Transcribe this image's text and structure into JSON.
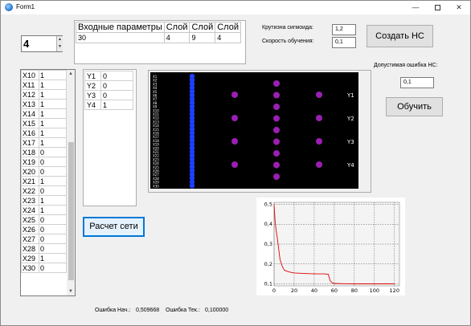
{
  "window": {
    "title": "Form1",
    "minimize": "—",
    "close": "✕"
  },
  "layers_count": "4",
  "input_params": {
    "header": [
      "Входные параметры",
      "Слой",
      "Слой",
      "Слой"
    ],
    "row": [
      "30",
      "4",
      "9",
      "4"
    ]
  },
  "sigmoid": {
    "label": "Крутизна сигмоида:",
    "value": "1,2"
  },
  "learning_rate": {
    "label": "Скорость обучения:",
    "value": "0,1"
  },
  "create_button": "Создать НС",
  "tolerance": {
    "label": "Допустимая ошибка НС:",
    "value": "0,1"
  },
  "train_button": "Обучить",
  "calc_button": "Расчет сети",
  "x_inputs": [
    {
      "k": "X10",
      "v": "1"
    },
    {
      "k": "X11",
      "v": "1"
    },
    {
      "k": "X12",
      "v": "1"
    },
    {
      "k": "X13",
      "v": "1"
    },
    {
      "k": "X14",
      "v": "1"
    },
    {
      "k": "X15",
      "v": "1"
    },
    {
      "k": "X16",
      "v": "1"
    },
    {
      "k": "X17",
      "v": "1"
    },
    {
      "k": "X18",
      "v": "0"
    },
    {
      "k": "X19",
      "v": "0"
    },
    {
      "k": "X20",
      "v": "0"
    },
    {
      "k": "X21",
      "v": "1"
    },
    {
      "k": "X22",
      "v": "0"
    },
    {
      "k": "X23",
      "v": "1"
    },
    {
      "k": "X24",
      "v": "1"
    },
    {
      "k": "X25",
      "v": "0"
    },
    {
      "k": "X26",
      "v": "0"
    },
    {
      "k": "X27",
      "v": "0"
    },
    {
      "k": "X28",
      "v": "0"
    },
    {
      "k": "X29",
      "v": "1"
    },
    {
      "k": "X30",
      "v": "0"
    }
  ],
  "y_outputs": [
    {
      "k": "Y1",
      "v": "0"
    },
    {
      "k": "Y2",
      "v": "0"
    },
    {
      "k": "Y3",
      "v": "0"
    },
    {
      "k": "Y4",
      "v": "1"
    }
  ],
  "network": {
    "output_labels": [
      "Y1",
      "Y2",
      "Y3",
      "Y4"
    ],
    "input_neuron_color": "#1f3fff",
    "hidden_neuron_color": "#9b1fb3",
    "layers": [
      30,
      4,
      9,
      4
    ]
  },
  "chart_data": {
    "type": "line",
    "series": [
      {
        "color": "#e00000",
        "x": [
          0,
          1,
          2,
          3,
          4,
          5,
          6,
          8,
          10,
          12,
          15,
          20,
          30,
          40,
          50,
          54,
          56,
          58,
          60,
          70,
          80,
          90,
          100,
          110,
          120
        ],
        "y": [
          0.5,
          0.42,
          0.37,
          0.34,
          0.3,
          0.26,
          0.22,
          0.19,
          0.17,
          0.165,
          0.16,
          0.155,
          0.152,
          0.15,
          0.15,
          0.148,
          0.115,
          0.105,
          0.102,
          0.101,
          0.1,
          0.1,
          0.1,
          0.1,
          0.1
        ]
      }
    ],
    "xticks": [
      "0",
      "20",
      "40",
      "60",
      "80",
      "100",
      "120"
    ],
    "yticks": [
      "0,1",
      "0,2",
      "0,3",
      "0,4",
      "0,5"
    ],
    "xlim": [
      0,
      125
    ],
    "ylim": [
      0.09,
      0.51
    ],
    "grid": true
  },
  "status": {
    "initial_label": "Ошибка Нач.:",
    "initial_value": "0,509668",
    "current_label": "Ошибка Тек.:",
    "current_value": "0,100000"
  }
}
